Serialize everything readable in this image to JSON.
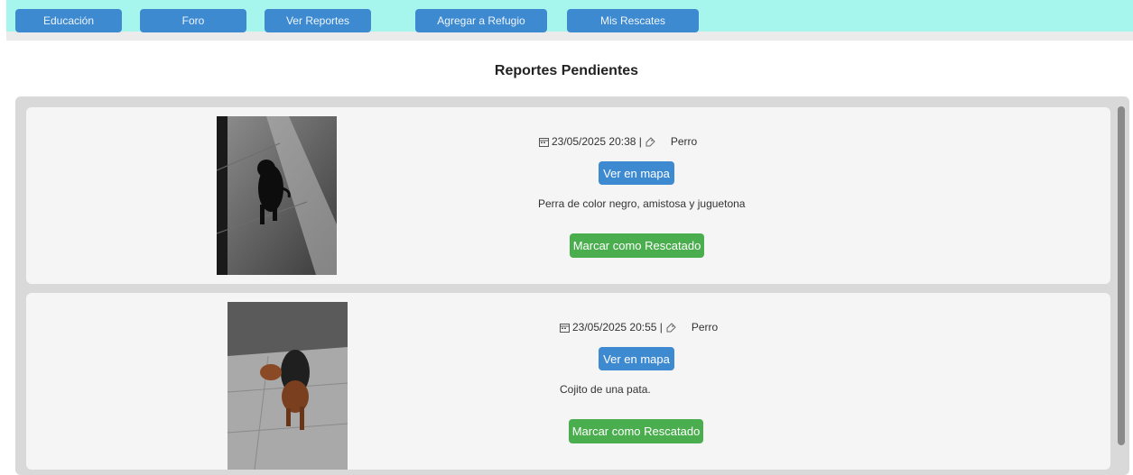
{
  "nav": {
    "items": [
      "Educación",
      "Foro",
      "Ver Reportes",
      "Agregar a Refugio",
      "Mis Rescates"
    ]
  },
  "page_title": "Reportes Pendientes",
  "reports": [
    {
      "date": "23/05/2025 20:38 |",
      "species": "Perro",
      "map_label": "Ver en mapa",
      "description": "Perra de color negro, amistosa y juguetona",
      "rescue_label": "Marcar como Rescatado"
    },
    {
      "date": "23/05/2025 20:55 |",
      "species": "Perro",
      "map_label": "Ver en mapa",
      "description": "Cojito de una pata.",
      "rescue_label": "Marcar como Rescatado"
    }
  ],
  "colors": {
    "topbar": "#a6f6ee",
    "primary": "#3d8ad1",
    "success": "#4aad4e"
  }
}
